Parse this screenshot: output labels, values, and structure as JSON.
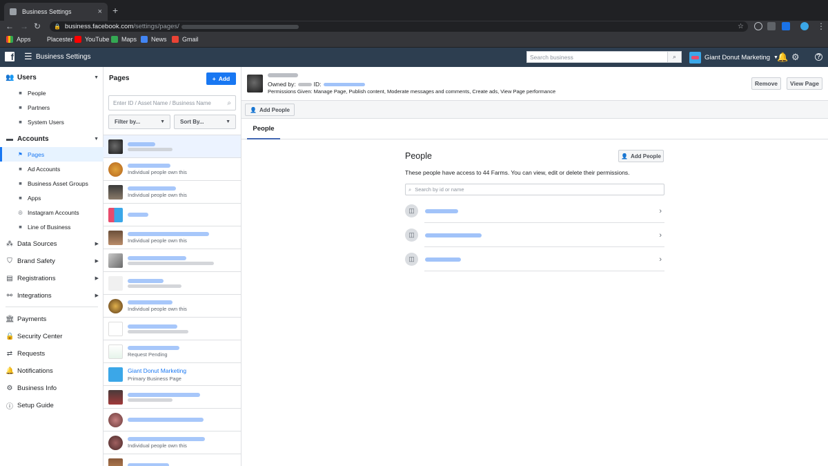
{
  "browser": {
    "tab_title": "Business Settings",
    "tab_close": "×",
    "new_tab": "+",
    "url_host": "business.facebook.com",
    "url_path": "/settings/pages/",
    "bookmarks": [
      "Apps",
      "Placester",
      "YouTube",
      "Maps",
      "News",
      "Gmail"
    ]
  },
  "topbar": {
    "logo": "f",
    "title": "Business Settings",
    "search_placeholder": "Search business",
    "business_name": "Giant Donut Marketing"
  },
  "sidebar": {
    "users_label": "Users",
    "users_items": [
      "People",
      "Partners",
      "System Users"
    ],
    "accounts_label": "Accounts",
    "accounts_items": [
      "Pages",
      "Ad Accounts",
      "Business Asset Groups",
      "Apps",
      "Instagram Accounts",
      "Line of Business"
    ],
    "sections": [
      "Data Sources",
      "Brand Safety",
      "Registrations",
      "Integrations"
    ],
    "bottom_items": [
      "Payments",
      "Security Center",
      "Requests",
      "Notifications",
      "Business Info",
      "Setup Guide"
    ]
  },
  "pages_panel": {
    "title": "Pages",
    "add_label": "Add",
    "search_placeholder": "Enter ID / Asset Name / Business Name",
    "filter_label": "Filter by...",
    "sort_label": "Sort By...",
    "rows": [
      {
        "name": "",
        "sub": ""
      },
      {
        "name": "",
        "sub": "Individual people own this"
      },
      {
        "name": "",
        "sub": "Individual people own this"
      },
      {
        "name": "",
        "sub": ""
      },
      {
        "name": "",
        "sub": "Individual people own this"
      },
      {
        "name": "",
        "sub": ""
      },
      {
        "name": "",
        "sub": ""
      },
      {
        "name": "",
        "sub": "Individual people own this"
      },
      {
        "name": "",
        "sub": ""
      },
      {
        "name": "",
        "sub": "Request Pending"
      },
      {
        "name": "Giant Donut Marketing",
        "sub": "Primary Business Page"
      },
      {
        "name": "",
        "sub": ""
      },
      {
        "name": "",
        "sub": ""
      },
      {
        "name": "",
        "sub": "Individual people own this"
      },
      {
        "name": "",
        "sub": ""
      }
    ]
  },
  "detail": {
    "owned_by": "Owned by:",
    "id_label": "ID:",
    "permissions": "Permissions Given: Manage Page, Publish content, Moderate messages and comments, Create ads, View Page performance",
    "remove_label": "Remove",
    "view_page_label": "View Page",
    "add_people_label": "Add People",
    "tab_people": "People"
  },
  "people_section": {
    "title": "People",
    "add_label": "Add People",
    "description": "These people have access to 44 Farms. You can view, edit or delete their permissions.",
    "search_placeholder": "Search by id or name"
  },
  "colors": {
    "fb_blue": "#1877f2",
    "topbar": "#2d3e50",
    "chrome_dark": "#202124"
  }
}
